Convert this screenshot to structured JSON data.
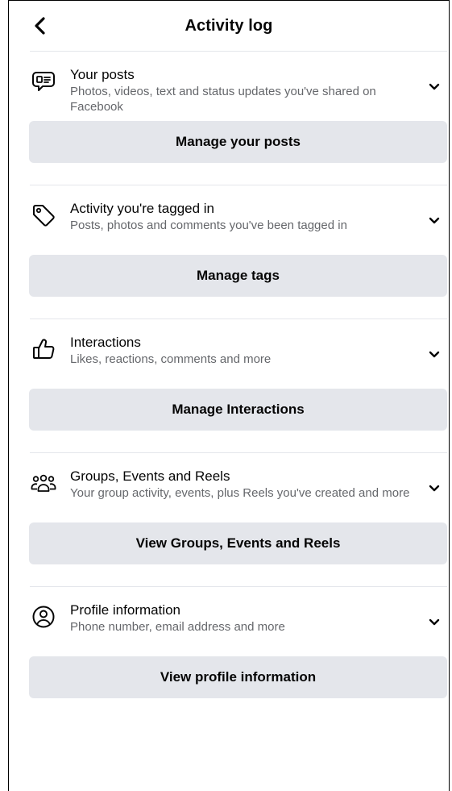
{
  "header": {
    "title": "Activity log"
  },
  "sections": [
    {
      "title": "Your posts",
      "subtitle": "Photos, videos, text and status updates you've shared on Facebook",
      "button": "Manage your posts",
      "icon": "posts-icon"
    },
    {
      "title": "Activity you're tagged in",
      "subtitle": "Posts, photos and comments you've been tagged in",
      "button": "Manage tags",
      "icon": "tag-icon"
    },
    {
      "title": "Interactions",
      "subtitle": "Likes, reactions, comments and more",
      "button": "Manage Interactions",
      "icon": "thumbs-up-icon"
    },
    {
      "title": "Groups, Events and Reels",
      "subtitle": "Your group activity, events, plus Reels you've created and more",
      "button": "View Groups, Events and Reels",
      "icon": "groups-icon"
    },
    {
      "title": "Profile information",
      "subtitle": "Phone number, email address and more",
      "button": "View profile information",
      "icon": "profile-icon"
    }
  ],
  "colors": {
    "text_primary": "#050505",
    "text_secondary": "#65676b",
    "button_bg": "#e4e6eb",
    "divider": "#e4e6eb"
  }
}
